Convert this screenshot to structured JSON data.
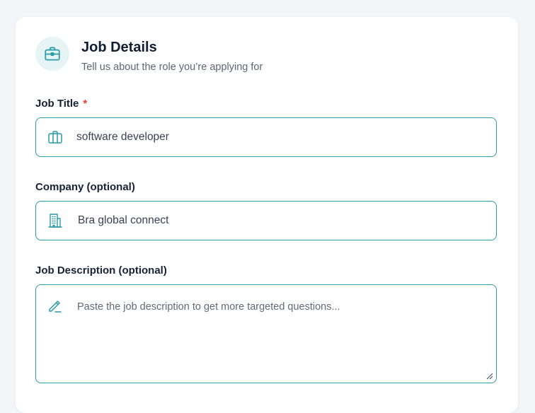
{
  "header": {
    "title": "Job Details",
    "subtitle": "Tell us about the role you’re applying for",
    "icon": "briefcase-icon"
  },
  "fields": {
    "job_title": {
      "label": "Job Title",
      "required_marker": "*",
      "value": "software developer",
      "icon": "briefcase-icon"
    },
    "company": {
      "label": "Company (optional)",
      "value": "Bra global connect",
      "icon": "building-icon"
    },
    "job_description": {
      "label": "Job Description (optional)",
      "placeholder": "Paste the job description to get more targeted questions...",
      "value": "",
      "icon": "pencil-icon"
    }
  },
  "colors": {
    "accent": "#2aa0ab",
    "required": "#e23b3b",
    "title": "#0f1e33",
    "muted": "#5b6676"
  }
}
